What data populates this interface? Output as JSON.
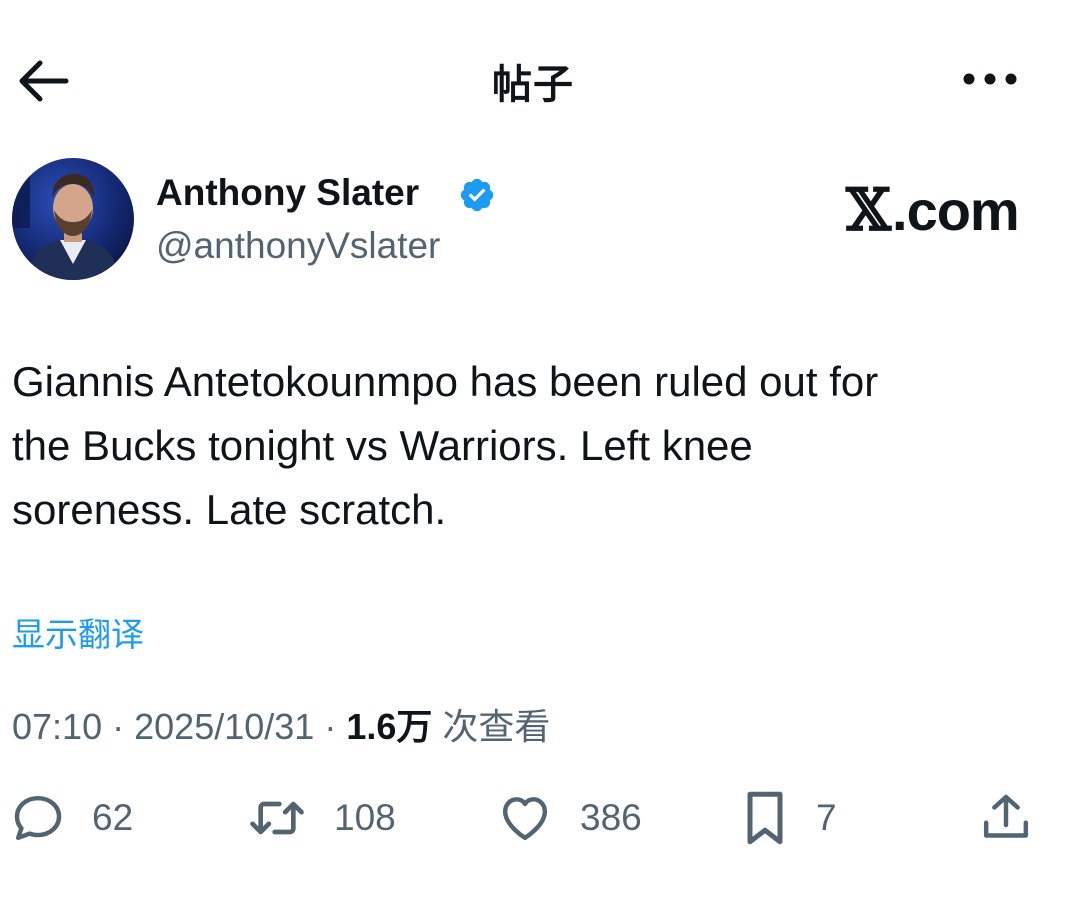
{
  "header": {
    "title": "帖子",
    "back_icon": "arrow-left-icon",
    "more_icon": "more-horizontal-icon"
  },
  "author": {
    "name": "Anthony Slater",
    "handle": "@anthonyVslater",
    "verified": true,
    "verified_color": "#1d9bf0"
  },
  "watermark": {
    "x": "𝕏",
    "text": ".com"
  },
  "tweet": {
    "text": "Giannis Antetokounmpo has been ruled out for\nthe Bucks tonight vs Warriors. Left knee\nsoreness. Late scratch.",
    "translate_label": "显示翻译"
  },
  "meta": {
    "time": "07:10",
    "separator": "·",
    "date": "2025/10/31",
    "views_count": "1.6万",
    "views_label": "次查看"
  },
  "actions": {
    "replies": "62",
    "retweets": "108",
    "likes": "386",
    "bookmarks": "7"
  },
  "colors": {
    "text": "#0f1419",
    "muted": "#536471",
    "link": "#1d9bf0"
  }
}
